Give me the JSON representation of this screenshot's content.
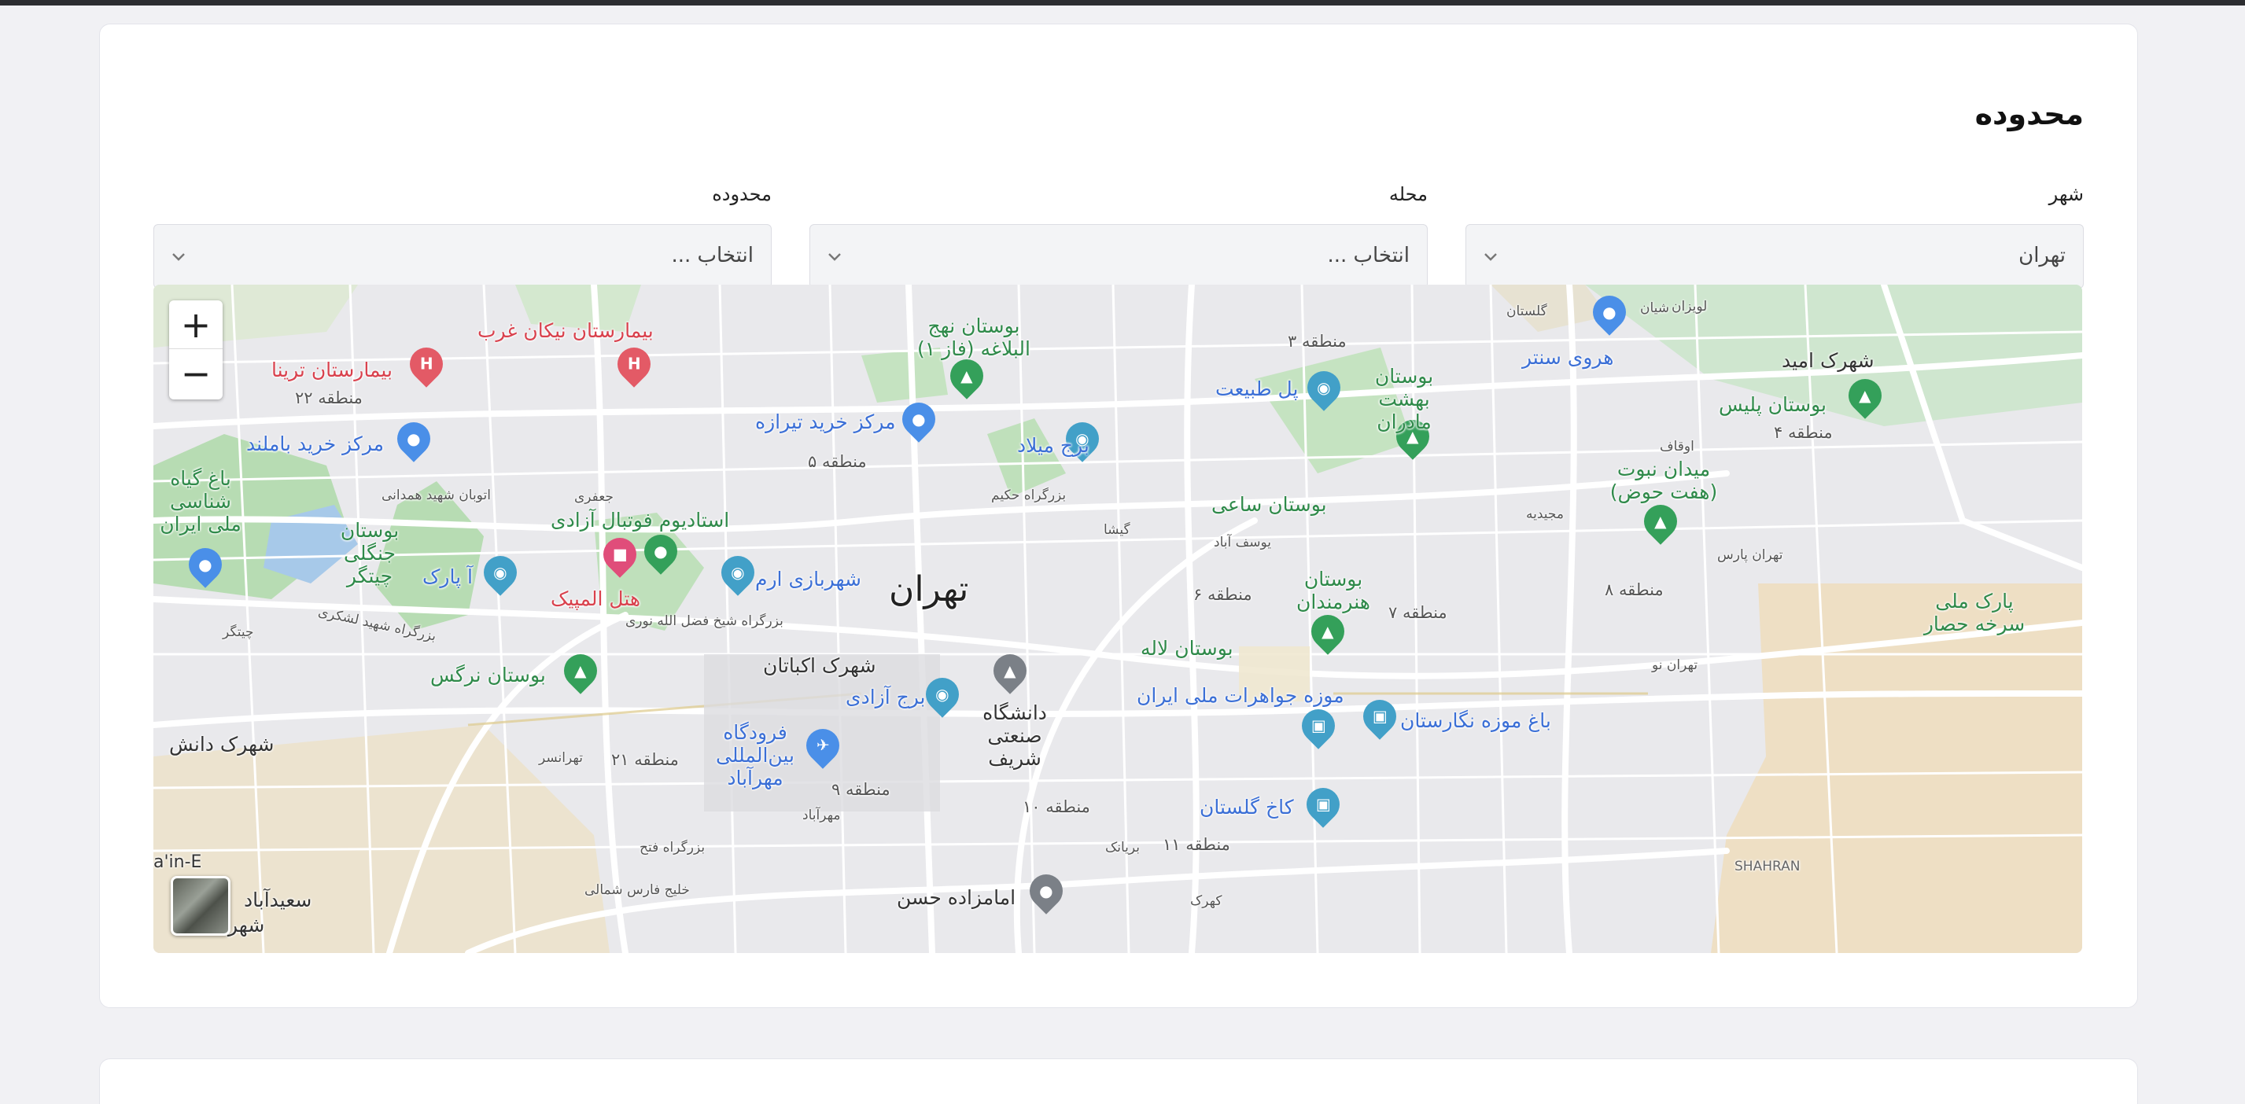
{
  "section": {
    "title": "محدوده"
  },
  "filters": {
    "city": {
      "label": "شهر",
      "value": "تهران"
    },
    "neighborhood": {
      "label": "محله",
      "placeholder": "انتخاب ..."
    },
    "area": {
      "label": "محدوده",
      "placeholder": "انتخاب ..."
    }
  },
  "map": {
    "zoom_in": "+",
    "zoom_out": "−",
    "city_label": "تهران",
    "places_blue": [
      "مرکز خرید تیرازه",
      "مرکز خرید باملند",
      "هروی سنتر",
      "برج میلاد",
      "پل طبیعت",
      "برج آزادی",
      "شهربازی ارم",
      "آ پارک",
      "موزه جواهرات ملی ایران",
      "باغ موزه نگارستان",
      "کاخ گلستان",
      "فرودگاه بین‌المللی مهرآباد"
    ],
    "places_green": [
      "بوستان نهج البلاغه (فاز ۱)",
      "بوستان بهشت مادران",
      "بوستان پلیس",
      "میدان نبوت (هفت حوض)",
      "بوستان ساعی",
      "بوستان هنرمندان",
      "بوستان لاله",
      "بوستان نرگس",
      "بوستان جنگلی چیتگر",
      "باغ گیاه شناسی ملی ایران",
      "پارک ملی سرخه حصار",
      "استادیوم فوتبال آزادی"
    ],
    "places_red": [
      "بیمارستان نیکان غرب",
      "بیمارستان ترینا",
      "هتل المپیک"
    ],
    "places_dark": [
      "شهرک امید",
      "دانشگاه صنعتی شریف",
      "شهرک اکباتان",
      "شهرک دانش",
      "امامزاده حسن",
      "سعیدآباد",
      "شهر"
    ],
    "districts": [
      "منطقه ۲۲",
      "منطقه ۵",
      "منطقه ۳",
      "منطقه ۴",
      "منطقه ۶",
      "منطقه ۷",
      "منطقه ۸",
      "منطقه ۹",
      "منطقه ۱۰",
      "منطقه ۱۱",
      "منطقه ۲۱"
    ],
    "minor": [
      "بزرگراه حکیم",
      "یوسف آباد",
      "گیشا",
      "تهران پارس",
      "تهرانسر",
      "مهرآباد",
      "بریانک",
      "گلستان",
      "شیان",
      "لویزان",
      "اوقاف",
      "مجیدیه",
      "تهران نو",
      "چیتگر",
      "جعفری",
      "اتوبان شهید همدانی",
      "بزرگراه شهید لشکری",
      "بزرگراه شیخ فضل الله نوری",
      "بزرگراه فتح",
      "خلیج فارس شمالی",
      "کهرک",
      "SHAHRAN",
      "a'in-E"
    ],
    "colors": {
      "green": "#2f8a4a",
      "blue": "#3b6fd6",
      "red": "#d9414d"
    }
  }
}
